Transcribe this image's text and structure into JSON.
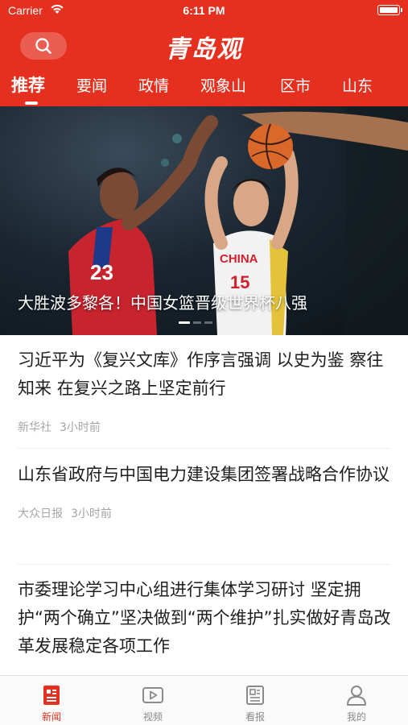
{
  "status_bar": {
    "carrier": "Carrier",
    "time": "6:11 PM"
  },
  "header": {
    "logo": "青岛观"
  },
  "tabs": [
    {
      "label": "推荐",
      "active": true
    },
    {
      "label": "要闻"
    },
    {
      "label": "政情"
    },
    {
      "label": "观象山"
    },
    {
      "label": "区市"
    },
    {
      "label": "山东"
    }
  ],
  "banner": {
    "caption": "大胜波多黎各！中国女篮晋级世界杯八强",
    "jersey_left": "23",
    "jersey_right": "CHINA",
    "jersey_right_num": "15",
    "slide_index": 1,
    "slide_count": 3
  },
  "news": [
    {
      "title": "习近平为《复兴文库》作序言强调 以史为鉴 察往知来 在复兴之路上坚定前行",
      "source": "新华社",
      "time": "3小时前"
    },
    {
      "title": "山东省政府与中国电力建设集团签署战略合作协议",
      "source": "大众日报",
      "time": "3小时前"
    },
    {
      "title": "市委理论学习中心组进行集体学习研讨 坚定拥护“两个确立”坚决做到“两个维护”扎实做好青岛改革发展稳定各项工作",
      "source": "",
      "time": ""
    }
  ],
  "tabbar": [
    {
      "label": "新闻",
      "icon": "news-icon",
      "active": true
    },
    {
      "label": "视频",
      "icon": "video-icon"
    },
    {
      "label": "看报",
      "icon": "newspaper-icon"
    },
    {
      "label": "我的",
      "icon": "profile-icon"
    }
  ],
  "colors": {
    "brand": "#e5301f",
    "meta": "#a5a5a5",
    "tab_inactive": "#8a8a8a"
  }
}
